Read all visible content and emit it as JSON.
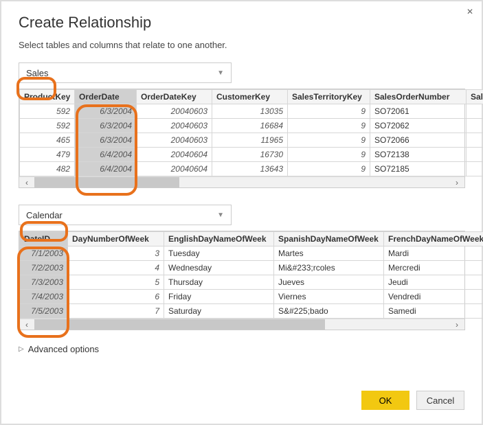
{
  "dialog": {
    "title": "Create Relationship",
    "subtitle": "Select tables and columns that relate to one another.",
    "close": "✕"
  },
  "dropdown1": {
    "value": "Sales"
  },
  "table1": {
    "cols": [
      "ProductKey",
      "OrderDate",
      "OrderDateKey",
      "CustomerKey",
      "SalesTerritoryKey",
      "SalesOrderNumber",
      "SalesOrder"
    ],
    "rows": [
      [
        "592",
        "6/3/2004",
        "20040603",
        "13035",
        "9",
        "SO72061",
        ""
      ],
      [
        "592",
        "6/3/2004",
        "20040603",
        "16684",
        "9",
        "SO72062",
        ""
      ],
      [
        "465",
        "6/3/2004",
        "20040603",
        "11965",
        "9",
        "SO72066",
        ""
      ],
      [
        "479",
        "6/4/2004",
        "20040604",
        "16730",
        "9",
        "SO72138",
        ""
      ],
      [
        "482",
        "6/4/2004",
        "20040604",
        "13643",
        "9",
        "SO72185",
        ""
      ]
    ],
    "selectedCol": 1
  },
  "dropdown2": {
    "value": "Calendar"
  },
  "table2": {
    "cols": [
      "DateID",
      "DayNumberOfWeek",
      "EnglishDayNameOfWeek",
      "SpanishDayNameOfWeek",
      "FrenchDayNameOfWeek"
    ],
    "rows": [
      [
        "7/1/2003",
        "3",
        "Tuesday",
        "Martes",
        "Mardi"
      ],
      [
        "7/2/2003",
        "4",
        "Wednesday",
        "Mi&#233;rcoles",
        "Mercredi"
      ],
      [
        "7/3/2003",
        "5",
        "Thursday",
        "Jueves",
        "Jeudi"
      ],
      [
        "7/4/2003",
        "6",
        "Friday",
        "Viernes",
        "Vendredi"
      ],
      [
        "7/5/2003",
        "7",
        "Saturday",
        "S&#225;bado",
        "Samedi"
      ]
    ],
    "selectedCol": 0
  },
  "advanced": {
    "label": "Advanced options"
  },
  "buttons": {
    "ok": "OK",
    "cancel": "Cancel"
  }
}
